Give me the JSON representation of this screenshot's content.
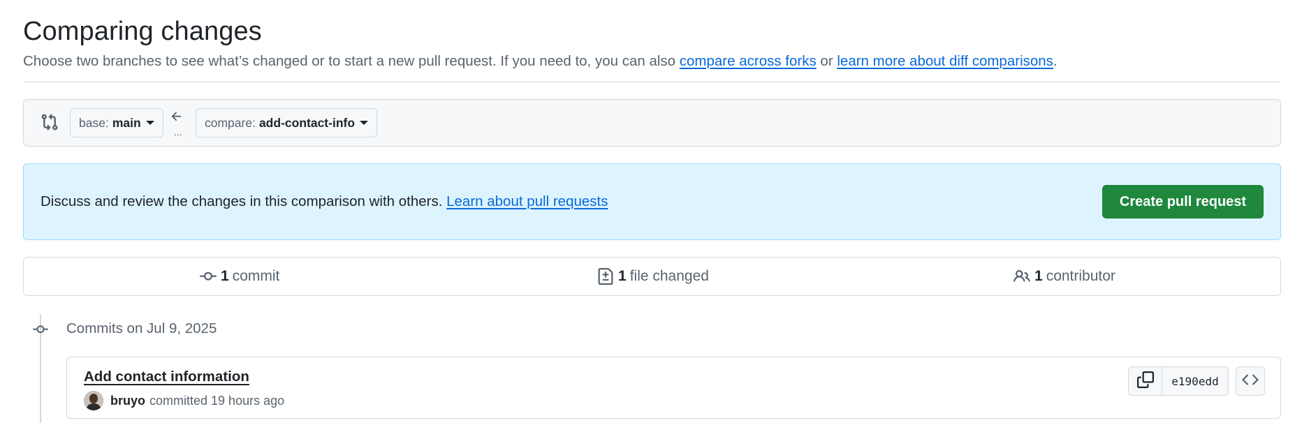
{
  "page": {
    "title": "Comparing changes",
    "subtitle_pre": "Choose two branches to see what’s changed or to start a new pull request. If you need to, you can also ",
    "compare_forks_link": "compare across forks",
    "subtitle_mid": " or ",
    "diff_link": "learn more about diff comparisons",
    "subtitle_end": "."
  },
  "range": {
    "base_label": "base:",
    "base_branch": "main",
    "compare_label": "compare:",
    "compare_branch": "add-contact-info",
    "dots": "..."
  },
  "info": {
    "text": "Discuss and review the changes in this comparison with others. ",
    "link": "Learn about pull requests",
    "create_button": "Create pull request"
  },
  "stats": {
    "commits_count": "1",
    "commits_label": "commit",
    "files_count": "1",
    "files_label": "file changed",
    "contributors_count": "1",
    "contributors_label": "contributor"
  },
  "timeline": {
    "date_heading": "Commits on Jul 9, 2025",
    "commit": {
      "title": "Add contact information",
      "author": "bruyo",
      "meta": "committed 19 hours ago",
      "sha": "e190edd"
    }
  },
  "colors": {
    "accent_link": "#0969da",
    "primary_button": "#1f883d",
    "info_background": "#ddf4ff",
    "border": "#d1d9e0"
  },
  "icons": [
    "git-compare-icon",
    "arrow-left-icon",
    "git-commit-icon",
    "file-diff-icon",
    "people-icon",
    "copy-icon",
    "code-icon"
  ]
}
